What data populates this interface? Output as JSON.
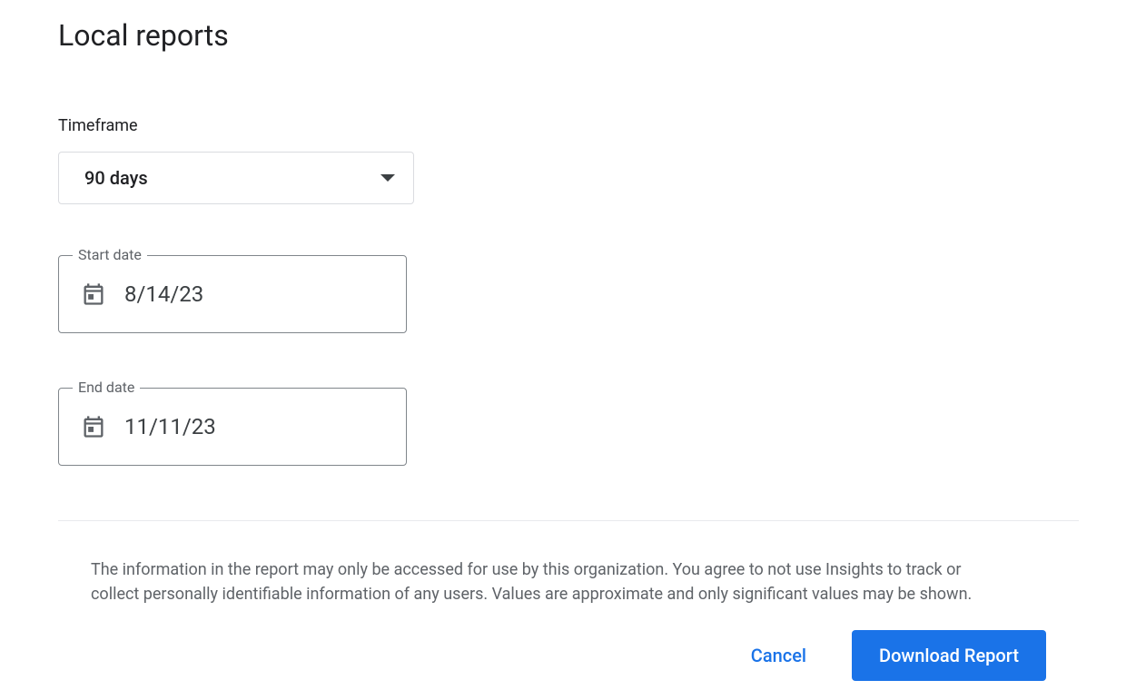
{
  "page": {
    "title": "Local reports"
  },
  "timeframe": {
    "label": "Timeframe",
    "selected": "90 days"
  },
  "start_date": {
    "label": "Start date",
    "value": "8/14/23"
  },
  "end_date": {
    "label": "End date",
    "value": "11/11/23"
  },
  "disclaimer": "The information in the report may only be accessed for use by this organization. You agree to not use Insights to track or collect personally identifiable information of any users. Values are approximate and only significant values may be shown.",
  "buttons": {
    "cancel": "Cancel",
    "download": "Download Report"
  }
}
